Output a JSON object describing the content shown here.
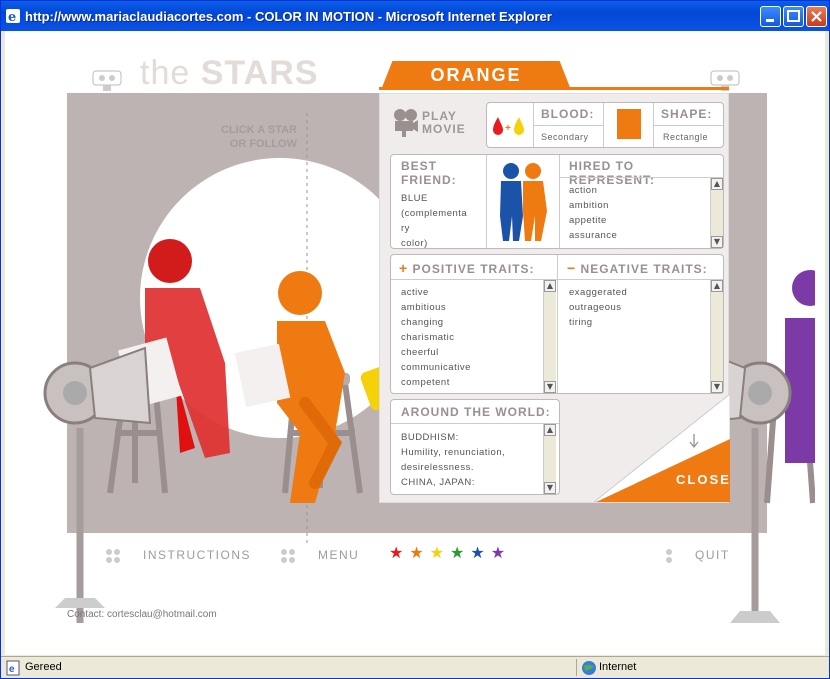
{
  "window": {
    "title": "http://www.mariaclaudiacortes.com - COLOR IN MOTION - Microsoft Internet Explorer",
    "status_left": "Gereed",
    "status_zone": "Internet"
  },
  "page": {
    "logo_light": "the ",
    "logo_bold": "STARS",
    "hint_line1": "CLICK A STAR",
    "hint_line2": "OR FOLLOW",
    "nav_instructions": "INSTRUCTIONS",
    "nav_menu": "MENU",
    "nav_quit": "QUIT",
    "contact": "Contact: cortesclau@hotmail.com",
    "star_colors": [
      "#e81c1c",
      "#f07a12",
      "#f5d10a",
      "#2c9a2c",
      "#1b53a8",
      "#7b3aa5"
    ]
  },
  "panel": {
    "title": "ORANGE",
    "play_line1": "PLAY",
    "play_line2": "MOVIE",
    "blood_label": "BLOOD:",
    "blood_value": "Secondary",
    "shape_label": "SHAPE:",
    "shape_value": "Rectangle",
    "best_friend_line1": "BEST",
    "best_friend_line2": "FRIEND:",
    "best_friend_text": [
      "BLUE",
      "(complementa",
      "ry",
      "color)"
    ],
    "hired_label": "HIRED TO REPRESENT:",
    "hired_items": [
      "action",
      "ambition",
      "appetite",
      "assurance"
    ],
    "positive_label": "POSITIVE TRAITS:",
    "positive_items": [
      "active",
      "ambitious",
      "changing",
      "charismatic",
      "cheerful",
      "communicative",
      "competent"
    ],
    "negative_label": "NEGATIVE TRAITS:",
    "negative_items": [
      "exaggerated",
      "outrageous",
      "tiring"
    ],
    "world_label": "AROUND THE WORLD:",
    "world_items": [
      "BUDDHISM:",
      "Humility, renunciation,",
      "desirelessness.",
      "CHINA, JAPAN:"
    ],
    "close_label": "CLOSE",
    "accent": "#f07a12"
  }
}
